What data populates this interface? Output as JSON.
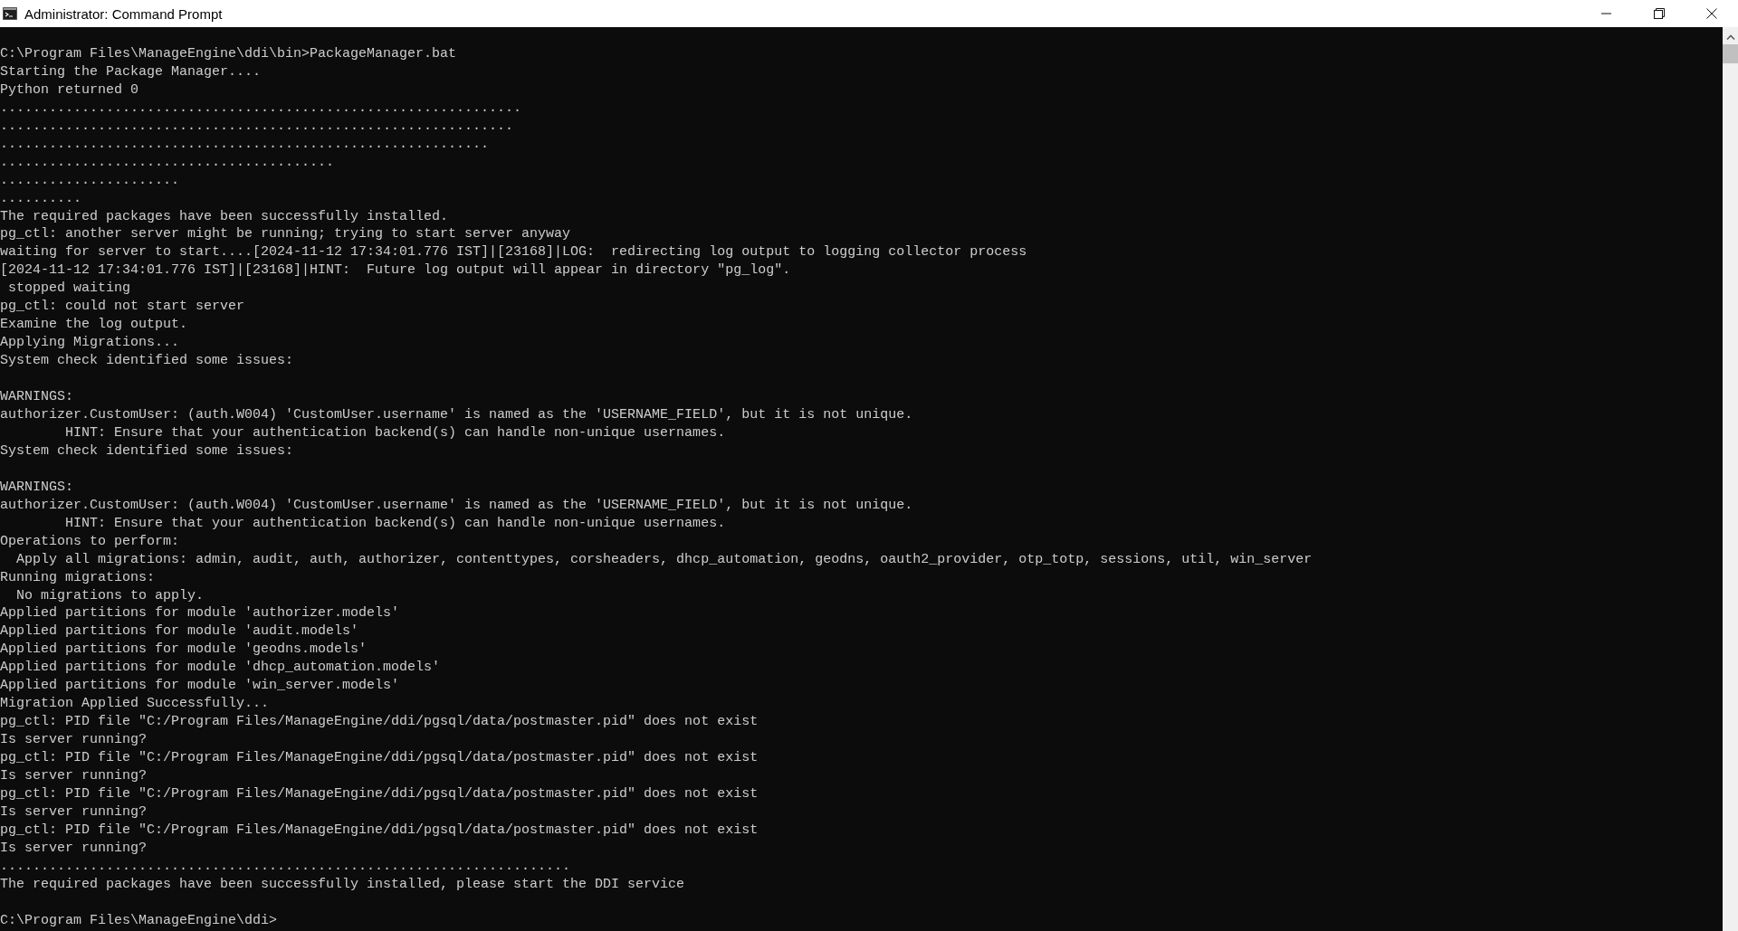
{
  "window": {
    "title": "Administrator: Command Prompt"
  },
  "console": {
    "blocks": [
      {
        "lines": [
          "C:\\Program Files\\ManageEngine\\ddi\\bin>PackageManager.bat",
          "Starting the Package Manager....",
          "Python returned 0",
          "................................................................",
          "...............................................................",
          "............................................................",
          ".........................................",
          "......................",
          "..........",
          "The required packages have been successfully installed.",
          "pg_ctl: another server might be running; trying to start server anyway",
          "waiting for server to start....[2024-11-12 17:34:01.776 IST]|[23168]|LOG:  redirecting log output to logging collector process",
          "[2024-11-12 17:34:01.776 IST]|[23168]|HINT:  Future log output will appear in directory \"pg_log\".",
          " stopped waiting",
          "pg_ctl: could not start server",
          "Examine the log output.",
          "Applying Migrations...",
          "System check identified some issues:"
        ]
      },
      {
        "lines": [
          "WARNINGS:",
          "authorizer.CustomUser: (auth.W004) 'CustomUser.username' is named as the 'USERNAME_FIELD', but it is not unique.",
          "        HINT: Ensure that your authentication backend(s) can handle non-unique usernames.",
          "System check identified some issues:"
        ]
      },
      {
        "lines": [
          "WARNINGS:",
          "authorizer.CustomUser: (auth.W004) 'CustomUser.username' is named as the 'USERNAME_FIELD', but it is not unique.",
          "        HINT: Ensure that your authentication backend(s) can handle non-unique usernames.",
          "Operations to perform:",
          "  Apply all migrations: admin, audit, auth, authorizer, contenttypes, corsheaders, dhcp_automation, geodns, oauth2_provider, otp_totp, sessions, util, win_server",
          "Running migrations:",
          "  No migrations to apply.",
          "Applied partitions for module 'authorizer.models'",
          "Applied partitions for module 'audit.models'",
          "Applied partitions for module 'geodns.models'",
          "Applied partitions for module 'dhcp_automation.models'",
          "Applied partitions for module 'win_server.models'",
          "Migration Applied Successfully...",
          "pg_ctl: PID file \"C:/Program Files/ManageEngine/ddi/pgsql/data/postmaster.pid\" does not exist",
          "Is server running?",
          "pg_ctl: PID file \"C:/Program Files/ManageEngine/ddi/pgsql/data/postmaster.pid\" does not exist",
          "Is server running?",
          "pg_ctl: PID file \"C:/Program Files/ManageEngine/ddi/pgsql/data/postmaster.pid\" does not exist",
          "Is server running?",
          "pg_ctl: PID file \"C:/Program Files/ManageEngine/ddi/pgsql/data/postmaster.pid\" does not exist",
          "Is server running?",
          "......................................................................",
          "The required packages have been successfully installed, please start the DDI service"
        ]
      },
      {
        "lines": [
          "C:\\Program Files\\ManageEngine\\ddi>"
        ]
      }
    ]
  }
}
